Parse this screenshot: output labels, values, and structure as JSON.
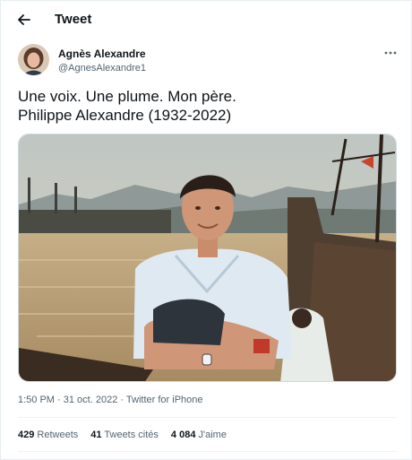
{
  "header": {
    "title": "Tweet"
  },
  "author": {
    "name": "Agnès Alexandre",
    "handle": "@AgnesAlexandre1"
  },
  "tweet": {
    "lines": [
      "Une voix. Une plume. Mon père.",
      "Philippe Alexandre (1932-2022)"
    ]
  },
  "meta": {
    "time": "1:50 PM",
    "sep": "·",
    "date": "31 oct. 2022",
    "source": "Twitter for iPhone"
  },
  "stats": {
    "retweets_count": "429",
    "retweets_label": "Retweets",
    "quotes_count": "41",
    "quotes_label": "Tweets cités",
    "likes_count": "4 084",
    "likes_label": "J'aime"
  },
  "icons": {
    "back": "arrow-left-icon",
    "more": "more-dots-icon"
  },
  "colors": {
    "text": "#0f1419",
    "secondary": "#536471",
    "divider": "#eff3f4"
  }
}
